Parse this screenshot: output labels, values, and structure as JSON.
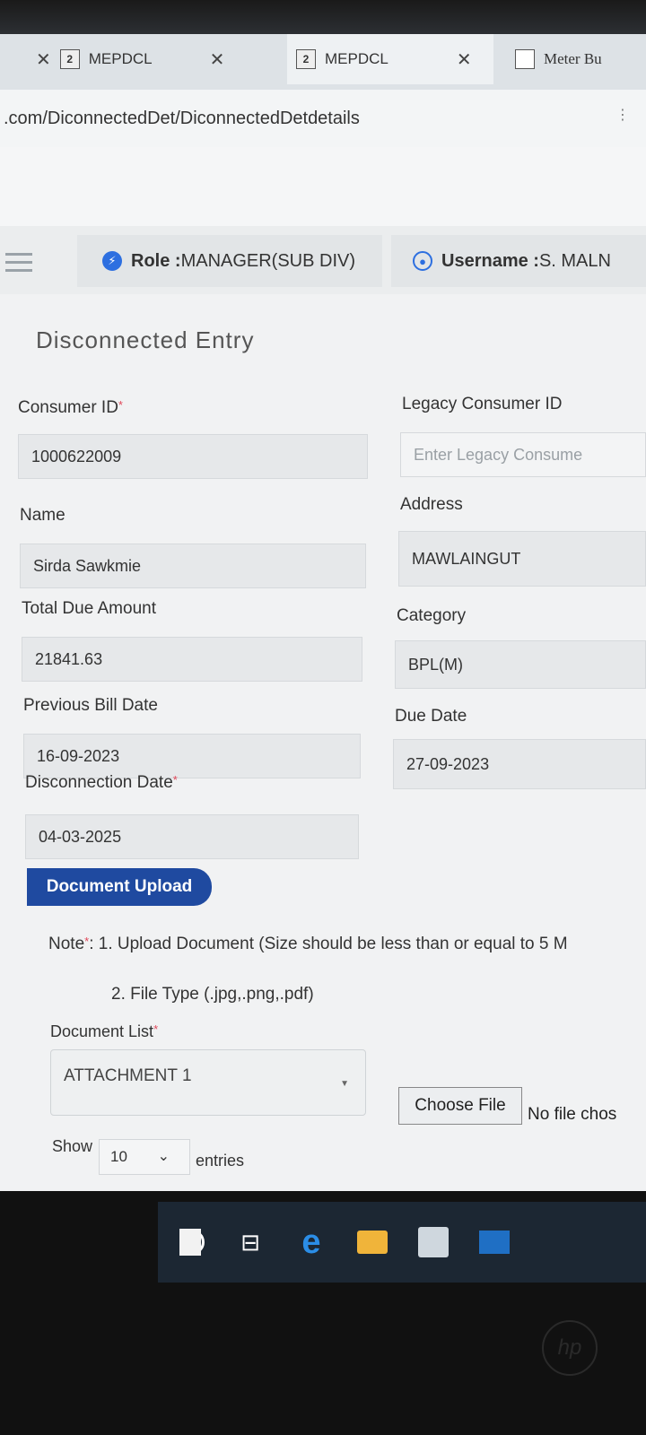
{
  "browser": {
    "tabs": [
      {
        "label": "MEPDCL"
      },
      {
        "label": "MEPDCL"
      },
      {
        "label": "Meter Bu"
      }
    ],
    "url": ".com/DiconnectedDet/DiconnectedDetdetails"
  },
  "header": {
    "role_label": "Role :",
    "role_value": "MANAGER(SUB DIV)",
    "username_label": "Username :",
    "username_value": "S. MALN"
  },
  "form": {
    "title": "Disconnected Entry",
    "consumer_id_label": "Consumer ID",
    "consumer_id_value": "1000622009",
    "legacy_id_label": "Legacy Consumer ID",
    "legacy_id_placeholder": "Enter Legacy Consume",
    "name_label": "Name",
    "name_value": "Sirda Sawkmie",
    "address_label": "Address",
    "address_value": "MAWLAINGUT",
    "total_due_label": "Total Due Amount",
    "total_due_value": "21841.63",
    "category_label": "Category",
    "category_value": "BPL(M)",
    "prev_bill_label": "Previous Bill Date",
    "prev_bill_value": "16-09-2023",
    "due_date_label": "Due Date",
    "due_date_value": "27-09-2023",
    "disconnection_label": "Disconnection Date",
    "disconnection_value": "04-03-2025",
    "required_mark": "*"
  },
  "upload": {
    "button_label": "Document Upload",
    "note_prefix": "Note",
    "note_line1": ": 1. Upload Document (Size should be less than or equal to 5 M",
    "note_line2": "2. File Type (.jpg,.png,.pdf)",
    "doc_list_label": "Document List",
    "doc_list_selected": "ATTACHMENT 1",
    "choose_file_label": "Choose File",
    "no_file_text": "No file chos"
  },
  "table": {
    "show_label": "Show",
    "entries_value": "10",
    "entries_label": "entries"
  },
  "taskbar": {
    "icons": [
      "cortana-icon",
      "task-view-icon",
      "edge-icon",
      "file-explorer-icon",
      "store-icon",
      "mail-icon",
      "notepad-icon"
    ],
    "hp_logo": "hp"
  },
  "colors": {
    "accent": "#1f4aa0",
    "required": "#e0485a",
    "role_icon": "#2d6fe0"
  }
}
